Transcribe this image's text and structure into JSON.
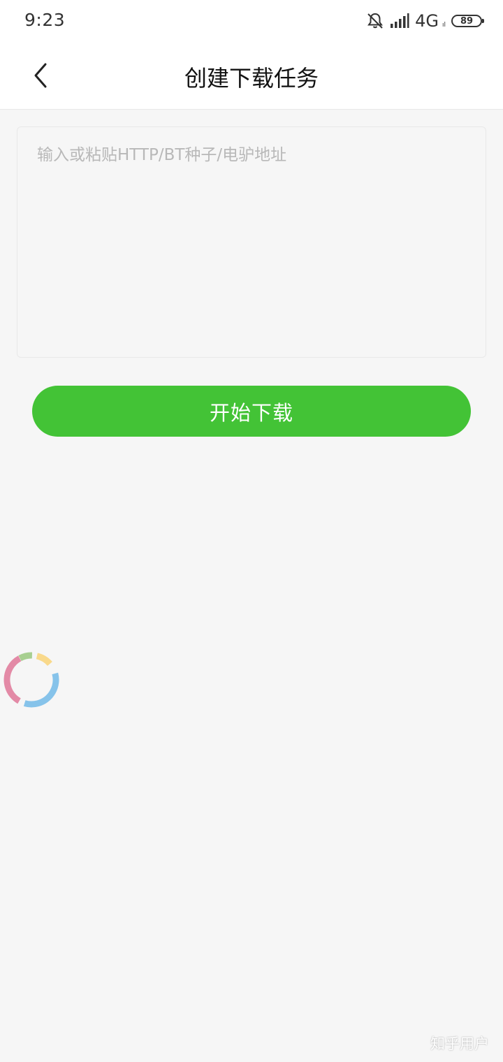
{
  "status_bar": {
    "time": "9:23",
    "network": "4G",
    "network_sub": "ıl",
    "battery": "89",
    "icons": [
      "bell-muted-icon",
      "signal-icon",
      "battery-icon"
    ]
  },
  "header": {
    "title": "创建下载任务",
    "back_icon": "chevron-left-icon"
  },
  "form": {
    "input_value": "",
    "input_placeholder": "输入或粘贴HTTP/BT种子/电驴地址",
    "start_label": "开始下载"
  },
  "colors": {
    "accent": "#43c336",
    "background": "#f6f6f6",
    "spinner_segments": [
      "#e38aa6",
      "#a7cf90",
      "#f9d98b",
      "#86c3ea"
    ]
  },
  "watermark": "知乎用户"
}
